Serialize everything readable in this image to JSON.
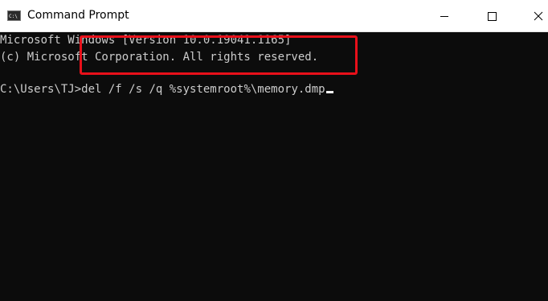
{
  "window": {
    "title": "Command Prompt",
    "icon": "cmd-icon",
    "controls": {
      "minimize_icon": "minimize-icon",
      "maximize_icon": "maximize-icon",
      "close_icon": "close-icon"
    }
  },
  "console": {
    "background": "#0c0c0c",
    "text_color": "#cccccc",
    "lines": [
      "Microsoft Windows [Version 10.0.19041.1165]",
      "(c) Microsoft Corporation. All rights reserved."
    ],
    "prompt": "C:\\Users\\TJ>",
    "command": "del /f /s /q %systemroot%\\memory.dmp"
  },
  "annotation": {
    "highlight_color": "#e8101a"
  }
}
